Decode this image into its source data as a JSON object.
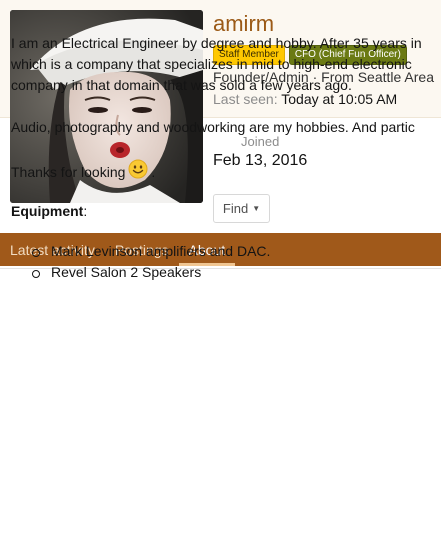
{
  "profile": {
    "username": "amirm",
    "banners": [
      "Staff Member",
      "CFO (Chief Fun Officer)"
    ],
    "blurb": "Founder/Admin · From Seattle Area",
    "last_seen_label": "Last seen:",
    "last_seen_value": "Today at 10:05 AM",
    "joined_label": "Joined",
    "joined_value": "Feb 13, 2016",
    "find_label": "Find"
  },
  "tabs": [
    {
      "label": "Latest activity",
      "active": false
    },
    {
      "label": "Postings",
      "active": false
    },
    {
      "label": "About",
      "active": true
    }
  ],
  "about": {
    "para1": [
      "I am an Electrical Engineer by degree and hobby. After 35 years in",
      "which is a company that specializes in mid to high-end electronic",
      "company in that domain that was sold a few years ago."
    ],
    "para2": "Audio, photography and woodworking are my hobbies. And partic",
    "thanks": "Thanks for looking",
    "thanks_end": ".",
    "equipment_label": "Equipment",
    "equipment_colon": ":",
    "equipment": [
      "Mark Levinson amplifiers and DAC.",
      "Revel Salon 2 Speakers"
    ]
  },
  "colors": {
    "brand": "#9b5a17",
    "tab_bar": "#a0591a",
    "staff_banner": "#ffc800",
    "cfo_banner": "#6b7a13"
  },
  "icons": [
    "smiley-emoji-icon",
    "chevron-down-icon"
  ]
}
